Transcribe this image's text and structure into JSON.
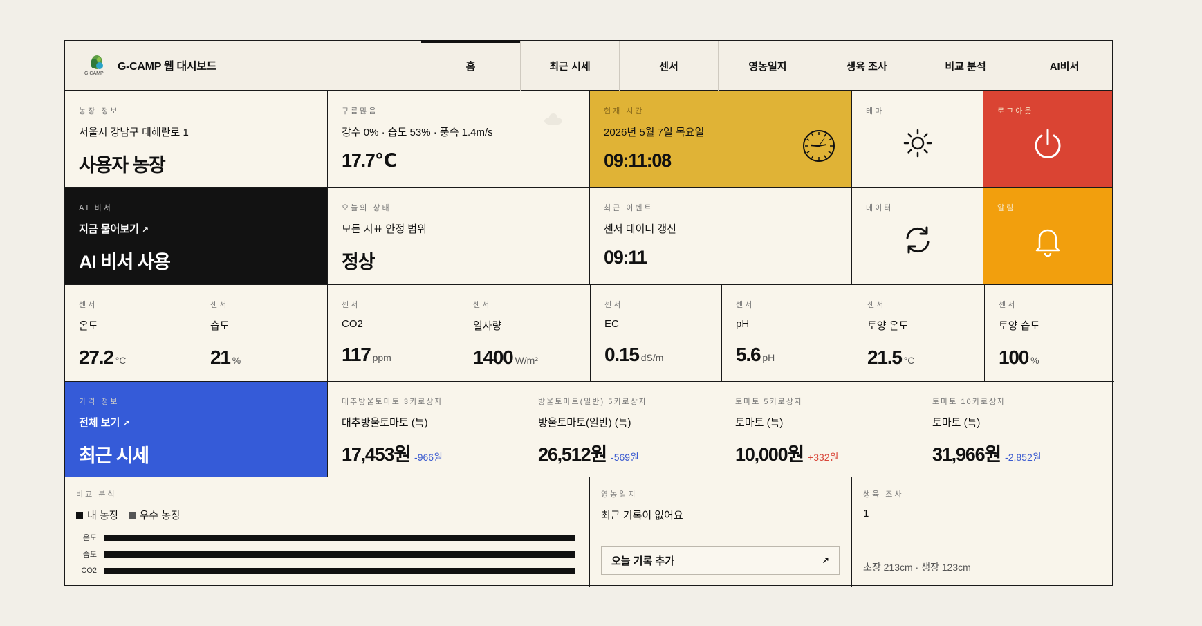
{
  "header": {
    "brand_title": "G-CAMP 웹 대시보드",
    "logo_text": "G CAMP",
    "nav": [
      "홈",
      "최근 시세",
      "센서",
      "영농일지",
      "생육 조사",
      "비교 분석",
      "AI비서"
    ],
    "active_nav": "홈"
  },
  "farm": {
    "label": "농장 정보",
    "address": "서울시 강남구 테헤란로 1",
    "name": "사용자 농장"
  },
  "weather": {
    "label": "구름많음",
    "detail": "강수 0% · 습도 53% · 풍속 1.4m/s",
    "temp": "17.7℃"
  },
  "clock": {
    "label": "현재 시간",
    "date": "2026년 5월 7일 목요일",
    "time": "09:11:08"
  },
  "theme": {
    "label": "테마",
    "icon": "sun-icon"
  },
  "logout": {
    "label": "로그아웃",
    "icon": "power-icon"
  },
  "ai": {
    "label": "AI 비서",
    "link": "지금 물어보기",
    "title": "AI 비서 사용"
  },
  "status": {
    "label": "오늘의 상태",
    "detail": "모든 지표 안정 범위",
    "value": "정상"
  },
  "event": {
    "label": "최근 이벤트",
    "detail": "센서 데이터 갱신",
    "time": "09:11"
  },
  "data_cell": {
    "label": "데이터",
    "icon": "refresh-icon"
  },
  "alarm": {
    "label": "알림",
    "icon": "bell-icon"
  },
  "sensors": [
    {
      "label": "센서",
      "name": "온도",
      "value": "27.2",
      "unit": "°C"
    },
    {
      "label": "센서",
      "name": "습도",
      "value": "21",
      "unit": "%"
    },
    {
      "label": "센서",
      "name": "CO2",
      "value": "117",
      "unit": "ppm"
    },
    {
      "label": "센서",
      "name": "일사량",
      "value": "1400",
      "unit": "W/m²"
    },
    {
      "label": "센서",
      "name": "EC",
      "value": "0.15",
      "unit": "dS/m"
    },
    {
      "label": "센서",
      "name": "pH",
      "value": "5.6",
      "unit": "pH"
    },
    {
      "label": "센서",
      "name": "토양 온도",
      "value": "21.5",
      "unit": "°C"
    },
    {
      "label": "센서",
      "name": "토양 습도",
      "value": "100",
      "unit": "%"
    }
  ],
  "price_info": {
    "label": "가격 정보",
    "link": "전체 보기",
    "title": "최근 시세"
  },
  "prices": [
    {
      "label": "대추방울토마토 3키로상자",
      "name": "대추방울토마토 (특)",
      "value": "17,453원",
      "delta": "-966원",
      "dir": "neg"
    },
    {
      "label": "방울토마토(일반) 5키로상자",
      "name": "방울토마토(일반) (특)",
      "value": "26,512원",
      "delta": "-569원",
      "dir": "neg"
    },
    {
      "label": "토마토 5키로상자",
      "name": "토마토 (특)",
      "value": "10,000원",
      "delta": "+332원",
      "dir": "pos"
    },
    {
      "label": "토마토 10키로상자",
      "name": "토마토 (특)",
      "value": "31,966원",
      "delta": "-2,852원",
      "dir": "neg"
    }
  ],
  "compare": {
    "label": "비교 분석",
    "legend": [
      "내 농장",
      "우수 농장"
    ],
    "colors": {
      "my": "#111111",
      "best": "#555555"
    },
    "rows": [
      {
        "name": "온도",
        "ratio": 1.0
      },
      {
        "name": "습도",
        "ratio": 1.0
      },
      {
        "name": "CO2",
        "ratio": 1.0
      }
    ]
  },
  "diary": {
    "label": "영농일지",
    "detail": "최근 기록이 없어요",
    "button": "오늘 기록 추가"
  },
  "growth": {
    "label": "생육 조사",
    "count": "1",
    "detail": "초장 213cm · 생장 123cm"
  }
}
